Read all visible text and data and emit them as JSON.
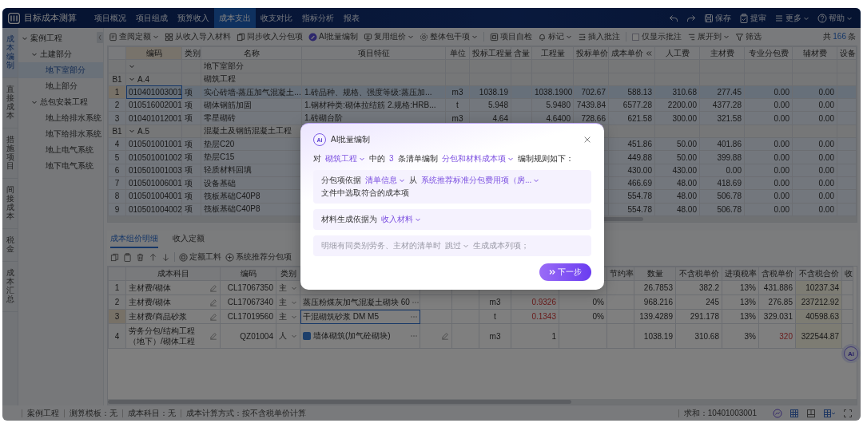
{
  "header": {
    "app_title": "目标成本测算",
    "nav": [
      {
        "label": "项目概况",
        "selected": false
      },
      {
        "label": "项目组成",
        "selected": false
      },
      {
        "label": "预算收入",
        "selected": false
      },
      {
        "label": "成本支出",
        "selected": true
      },
      {
        "label": "收支对比",
        "selected": false
      },
      {
        "label": "指标分析",
        "selected": false
      },
      {
        "label": "报表",
        "selected": false
      }
    ],
    "actions": [
      {
        "kind": "undo"
      },
      {
        "kind": "redo"
      },
      {
        "kind": "save",
        "label": "保存",
        "dropdown": false
      },
      {
        "kind": "submit",
        "label": "提审",
        "dropdown": false
      },
      {
        "kind": "more",
        "label": "更多",
        "dropdown": true
      },
      {
        "kind": "help",
        "label": "帮助",
        "dropdown": true
      }
    ]
  },
  "side_rail": [
    {
      "label": "成本编制",
      "selected": true
    },
    {
      "label": "直接成本",
      "selected": false
    },
    {
      "label": "措施项目",
      "selected": false
    },
    {
      "label": "间接成本",
      "selected": false
    },
    {
      "label": "税金",
      "selected": false
    },
    {
      "label": "成本汇总",
      "selected": false
    }
  ],
  "tree": [
    {
      "label": "案例工程",
      "expanded": true,
      "selected": false,
      "children": [
        {
          "label": "土建部分",
          "expanded": true,
          "selected": false,
          "children": [
            {
              "label": "地下室部分",
              "selected": true
            },
            {
              "label": "地上部分",
              "selected": false
            }
          ]
        },
        {
          "label": "总包安装工程",
          "expanded": true,
          "selected": false,
          "children": [
            {
              "label": "地上给排水系统",
              "selected": false
            },
            {
              "label": "地下给排水系统",
              "selected": false
            },
            {
              "label": "地上电气系统",
              "selected": false
            },
            {
              "label": "地下电气系统",
              "selected": false
            }
          ]
        }
      ]
    }
  ],
  "toolbar": {
    "items": [
      {
        "kind": "quota",
        "label": "查阅定额",
        "dropdown": true
      },
      {
        "kind": "import",
        "label": "从收入导入材料",
        "dropdown": false
      },
      {
        "kind": "sync",
        "label": "同步收入分包项",
        "dropdown": false
      },
      {
        "kind": "ai",
        "label": "AI批量编制",
        "dropdown": false
      },
      {
        "kind": "reuse",
        "label": "复用组价",
        "dropdown": true
      },
      {
        "kind": "lump",
        "label": "整体包干项",
        "dropdown": true
      },
      {
        "kind": "separator"
      },
      {
        "kind": "check",
        "label": "项目自检",
        "dropdown": false
      },
      {
        "kind": "mark",
        "label": "标记",
        "dropdown": true
      },
      {
        "kind": "annotate",
        "label": "插入批注",
        "dropdown": false
      },
      {
        "kind": "separator"
      },
      {
        "kind": "checkbox",
        "label": "仅显示批注",
        "checked": false
      },
      {
        "kind": "expand",
        "label": "展开到",
        "dropdown": true
      },
      {
        "kind": "filter",
        "label": "筛选",
        "dropdown": false
      }
    ],
    "count": {
      "prefix": "共",
      "value": "166",
      "suffix": "条"
    }
  },
  "boq_table": {
    "columns": [
      "编码",
      "类别",
      "名称",
      "项目特征",
      "单位",
      "投标工程量",
      "含量",
      "工程量",
      "投标单价",
      "成本单价",
      "人工费",
      "主材费",
      "专业分包费",
      "辅材费",
      "设备"
    ],
    "rows": [
      {
        "kind": "group",
        "expanded": true,
        "name": "地下室部分"
      },
      {
        "kind": "group",
        "label": "B1",
        "code": "A.4",
        "expanded": true,
        "name": "砌筑工程"
      },
      {
        "kind": "item",
        "row_no": "1",
        "selected": true,
        "cells": [
          "010401003001",
          "项",
          "实心砖墙-蒸压加气混凝土...",
          "1.砖品种、规格、强度等级:蒸压加...",
          "m3",
          "1038.19",
          null,
          "1038.1900",
          "702.67",
          "588.13",
          "310.68",
          "277.45",
          "0.00",
          "0.00",
          null
        ]
      },
      {
        "kind": "item",
        "row_no": "2",
        "selected": false,
        "cells": [
          "010516002001",
          "项",
          "砌体钢筋加固",
          "1.钢材种类:砌体拉结筋 2.规格:HRB...",
          "t",
          "5.948",
          null,
          "5.9480",
          "7439.84",
          "6577.28",
          "2200.00",
          "4377.28",
          "0.00",
          "0.00",
          null
        ]
      },
      {
        "kind": "item",
        "row_no": "3",
        "selected": false,
        "cells": [
          "010401012001",
          "项",
          "零星砌砖",
          "1.砖砌台阶",
          "m3",
          "4.64",
          null,
          "4.6400",
          "728.66",
          "621.58",
          "300.00",
          "321.58",
          "0.00",
          "0.00",
          null
        ]
      },
      {
        "kind": "group",
        "label": "B1",
        "code": "A.5",
        "expanded": true,
        "name": "混凝土及钢筋混凝土工程"
      },
      {
        "kind": "item",
        "row_no": "4",
        "selected": false,
        "cells": [
          "010501001001",
          "项",
          "垫层C20",
          null,
          null,
          null,
          null,
          null,
          null,
          "451.86",
          "50.00",
          "401.86",
          "0.00",
          "0.00",
          null
        ]
      },
      {
        "kind": "item",
        "row_no": "5",
        "selected": false,
        "cells": [
          "010501001002",
          "项",
          "垫层C15",
          null,
          null,
          null,
          null,
          null,
          null,
          "449.88",
          "50.00",
          "399.88",
          "0.00",
          "0.00",
          null
        ]
      },
      {
        "kind": "item",
        "row_no": "6",
        "selected": false,
        "cells": [
          "010501001003",
          "项",
          "轻质材料回填",
          null,
          null,
          null,
          null,
          null,
          null,
          "430.00",
          "430.00",
          "0.00",
          "0.00",
          "0.00",
          null
        ]
      },
      {
        "kind": "item",
        "row_no": "7",
        "selected": false,
        "cells": [
          "010501006001",
          "项",
          "设备基础",
          null,
          null,
          null,
          null,
          null,
          null,
          "466.69",
          "48.00",
          "418.69",
          "0.00",
          "0.00",
          null
        ]
      },
      {
        "kind": "item",
        "row_no": "8",
        "selected": false,
        "cells": [
          "010501004001",
          "项",
          "筏板基础C40P8",
          null,
          null,
          null,
          null,
          null,
          null,
          "554.78",
          "48.00",
          "506.78",
          "0.00",
          "0.00",
          null
        ]
      },
      {
        "kind": "item",
        "row_no": "9",
        "selected": false,
        "cells": [
          "010501004002",
          "项",
          "筏板基础C40P8",
          null,
          null,
          null,
          null,
          null,
          null,
          "554.78",
          "48.00",
          "506.78",
          "0.00",
          "0.00",
          null
        ]
      }
    ]
  },
  "detail": {
    "tabs": [
      {
        "label": "成本组价明细",
        "selected": true
      },
      {
        "label": "收入定额",
        "selected": false
      }
    ],
    "tools": [
      {
        "kind": "copy"
      },
      {
        "kind": "paste"
      },
      {
        "kind": "delete"
      },
      {
        "kind": "up"
      },
      {
        "kind": "down"
      },
      {
        "kind": "separator"
      },
      {
        "kind": "quota",
        "label": "定额工料"
      },
      {
        "kind": "recommend",
        "label": "系统推荐分包项"
      }
    ],
    "columns": [
      "成本科目",
      "编码",
      "类别",
      null,
      null,
      null,
      null,
      null,
      null,
      "节约率",
      "数量",
      "不含税单价",
      "进项税率",
      "含税单价",
      "不含税合价",
      "收"
    ],
    "rows": [
      {
        "row_no": "1",
        "kind": "material",
        "selected": false,
        "cells": [
          "主材费/砌体",
          "CL17067350",
          "主",
          null,
          null,
          null,
          null,
          null,
          null,
          null,
          "26.7853",
          "382.2",
          "13%",
          {
            "text": "431.886",
            "warning": false
          },
          "10237.34",
          null
        ]
      },
      {
        "row_no": "2",
        "kind": "material",
        "selected": false,
        "cells": [
          "主材费/砌体",
          "CL17067340",
          "主",
          "蒸压粉煤灰加气混凝土砌块 60",
          null,
          null,
          "m3",
          {
            "text": "0.9326",
            "warning": true
          },
          "0%",
          null,
          "968.216",
          "245",
          "13%",
          {
            "text": "276.85",
            "warning": false
          },
          "237212.92",
          null
        ]
      },
      {
        "row_no": "3",
        "kind": "material",
        "selected": true,
        "cells": [
          "主材费/商品砂浆",
          "CL17019560",
          "主",
          "干混砌筑砂浆 DM M5",
          null,
          null,
          "t",
          {
            "text": "0.1343",
            "warning": true
          },
          "0%",
          null,
          "139.4289",
          "291.178",
          "13%",
          {
            "text": "329.031",
            "warning": false
          },
          "40598.63",
          null
        ]
      },
      {
        "row_no": "4",
        "kind": "labor",
        "selected": false,
        "cells": [
          "劳务分包/结构工程（地下）/砌体工程",
          "QZ01004",
          "人",
          "墙体砌筑(加气砼砌块)",
          null,
          null,
          "m3",
          {
            "text": "1",
            "warning": false
          },
          null,
          null,
          "1038.19",
          "310.68",
          "3%",
          {
            "text": "320",
            "warning": true
          },
          "322544.87",
          null
        ]
      }
    ]
  },
  "status_bar": {
    "items": [
      "案例工程",
      "测算模板：无",
      "成本科目：无",
      "成本计算方式：按不含税单价计算"
    ],
    "sum": "求和：10401003001"
  },
  "ai_fab": {
    "label": "Ai"
  },
  "ai_dialog": {
    "badge": "Ai",
    "title": "AI批量编制",
    "intro": [
      {
        "kind": "text",
        "text": "对"
      },
      {
        "kind": "select",
        "text": "砌筑工程"
      },
      {
        "kind": "text",
        "text": "中的"
      },
      {
        "kind": "number",
        "text": "3"
      },
      {
        "kind": "text",
        "text": "条清单编制"
      },
      {
        "kind": "select",
        "text": "分包和材料成本项"
      },
      {
        "kind": "text",
        "text": "编制规则如下："
      }
    ],
    "rules": [
      {
        "muted": false,
        "segments": [
          {
            "kind": "text",
            "text": "分包项依据"
          },
          {
            "kind": "select",
            "text": "清单信息"
          },
          {
            "kind": "text",
            "text": "从"
          },
          {
            "kind": "select",
            "text": "系统推荐标准分包费用项（房..."
          },
          {
            "kind": "text",
            "text": "文件中选取符合的成本项"
          }
        ]
      },
      {
        "muted": false,
        "segments": [
          {
            "kind": "text",
            "text": "材料生成依据为"
          },
          {
            "kind": "select",
            "text": "收入材料"
          }
        ]
      },
      {
        "muted": true,
        "segments": [
          {
            "kind": "text",
            "text": "明细有同类别劳务、主材的清单时"
          },
          {
            "kind": "select",
            "text": "跳过"
          },
          {
            "kind": "text",
            "text": "生成成本列项；"
          }
        ]
      }
    ],
    "next_button": "下一步"
  }
}
